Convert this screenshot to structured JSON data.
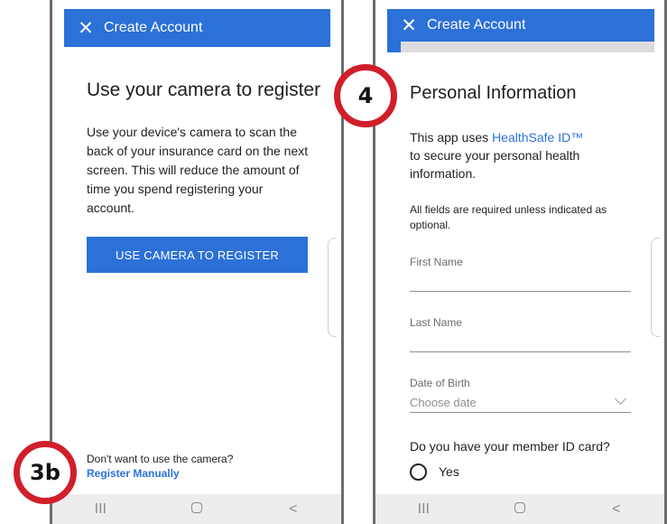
{
  "left": {
    "appbar": {
      "close_glyph": "✕",
      "title": "Create Account"
    },
    "heading": "Use your camera to register",
    "description": "Use your device's camera to scan the back of your insurance card on the next screen. This will reduce the amount of time you spend registering your account.",
    "camera_button_label": "USE CAMERA TO REGISTER",
    "footer_question": "Don't want to use the camera?",
    "footer_link": "Register Manually"
  },
  "right": {
    "appbar": {
      "close_glyph": "✕",
      "title": "Create Account"
    },
    "progress_fraction": 0.05,
    "heading": "Personal Information",
    "intro_prefix": "This app uses ",
    "intro_link": "HealthSafe ID™",
    "intro_suffix": "to secure your personal health information.",
    "required_note": "All fields are required unless indicated as optional.",
    "first_name_label": "First Name",
    "last_name_label": "Last Name",
    "dob_label": "Date of Birth",
    "dob_placeholder": "Choose date",
    "member_card_question": "Do you have your member ID card?",
    "yes_option": "Yes"
  },
  "navbar": {
    "recents_glyph": "III",
    "back_glyph": "<"
  },
  "badges": {
    "step_3b": "3b",
    "step_4": "4"
  },
  "colors": {
    "primary": "#2b71d8",
    "badge_ring": "#d01f2a",
    "frame": "#6d6d6d",
    "navbar_bg": "#ededed"
  }
}
